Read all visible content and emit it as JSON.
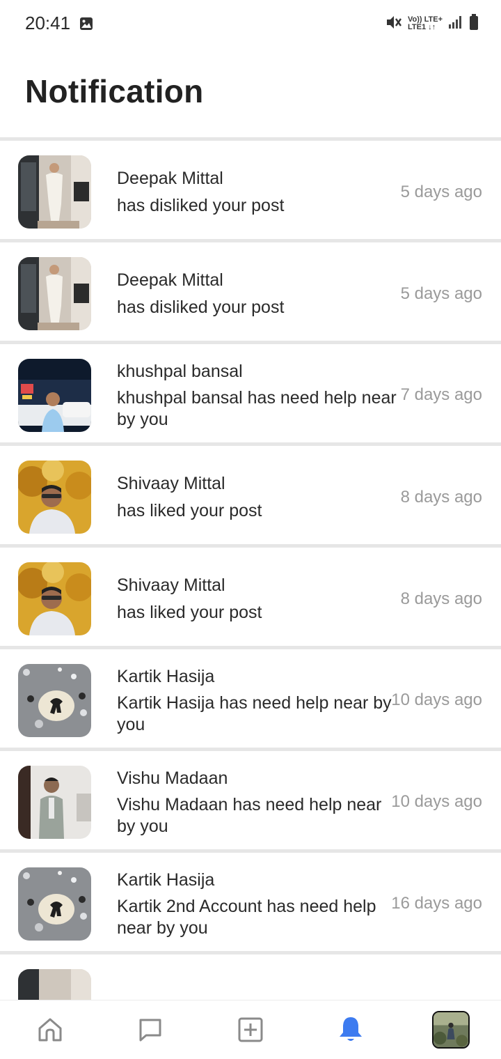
{
  "status_bar": {
    "time": "20:41",
    "network_line1": "Vo)) LTE+",
    "network_line2": "LTE1 ↓↑"
  },
  "header": {
    "title": "Notification"
  },
  "notifications": [
    {
      "name": "Deepak Mittal",
      "message": "has disliked your post",
      "time": "5 days ago",
      "avatar": "avatar-deepak"
    },
    {
      "name": "Deepak Mittal",
      "message": "has disliked your post",
      "time": "5 days ago",
      "avatar": "avatar-deepak"
    },
    {
      "name": "khushpal bansal",
      "message": "khushpal bansal has need help near by you",
      "time": "7 days ago",
      "avatar": "avatar-khushpal"
    },
    {
      "name": "Shivaay Mittal",
      "message": "has liked your post",
      "time": "8 days ago",
      "avatar": "avatar-shivaay"
    },
    {
      "name": "Shivaay Mittal",
      "message": "has liked your post",
      "time": "8 days ago",
      "avatar": "avatar-shivaay"
    },
    {
      "name": "Kartik Hasija",
      "message": "Kartik Hasija has need help near by you",
      "time": "10 days ago",
      "avatar": "avatar-kartik"
    },
    {
      "name": "Vishu Madaan",
      "message": "Vishu Madaan has need help near by you",
      "time": "10 days ago",
      "avatar": "avatar-vishu"
    },
    {
      "name": "Kartik Hasija",
      "message": "Kartik 2nd Account has need help near by you",
      "time": "16 days ago",
      "avatar": "avatar-kartik"
    }
  ],
  "tab_bar": {
    "items": [
      {
        "icon": "home-icon",
        "active": false
      },
      {
        "icon": "chat-icon",
        "active": false
      },
      {
        "icon": "add-post-icon",
        "active": false
      },
      {
        "icon": "bell-icon",
        "active": true
      },
      {
        "icon": "profile-avatar",
        "active": false
      }
    ],
    "active_color": "#3d7bf0",
    "inactive_color": "#8a8a8a"
  }
}
